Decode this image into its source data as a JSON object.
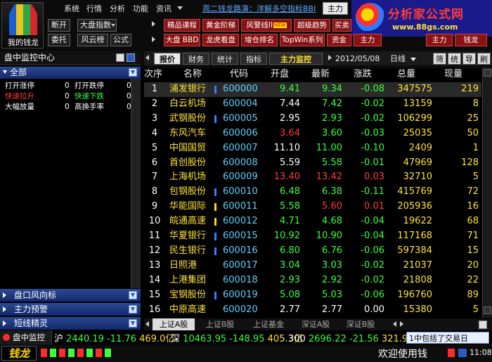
{
  "app": {
    "logo_label": "我的钱龙"
  },
  "menu": [
    "系统",
    "行情",
    "分析",
    "功能",
    "资讯"
  ],
  "banner": "周二钱龙路演：洋解多空指标BBI",
  "tab_main": "主力",
  "ad": {
    "title": "分析家公式网",
    "url": "www.88gs.com"
  },
  "toolbar1": {
    "duankai": "断开",
    "dapan": "大盘指数",
    "weituo": "委托",
    "fengyun": "风云榜",
    "gongshi": "公式"
  },
  "redbuttons_row1": [
    "精品课程",
    "黄金阶梯",
    "风警线II",
    "超级趋势",
    "买卖"
  ],
  "redbuttons_row2": [
    "大盘 BBD",
    "龙虎看盘",
    "增仓排名",
    "TopWin系列",
    "资金",
    "主力"
  ],
  "right_small_buttons": [
    "主力",
    "钱龙"
  ],
  "left_panel": {
    "title": "盘中监控中心",
    "header": "全部",
    "items": [
      {
        "label": "打开涨停",
        "value": "0",
        "label2": "打开跌停",
        "value2": "0",
        "c1": "#ffffff",
        "c2": "#ffffff"
      },
      {
        "label": "快速拉升",
        "value": "0",
        "label2": "快速下跌",
        "value2": "0",
        "c1": "#ff3b3b",
        "c2": "#3cff3c"
      },
      {
        "label": "大幅放量",
        "value": "0",
        "label2": "高换手率",
        "value2": "0",
        "c1": "#ffffff",
        "c2": "#ffffff"
      }
    ],
    "sections": [
      "盘口风向标",
      "主力预警",
      "短线精灵"
    ],
    "footer": "盘中监控"
  },
  "right_tabs": [
    "报价",
    "财务",
    "统计",
    "指标",
    "主力监控"
  ],
  "date": "2012/05/08",
  "period": "日线",
  "side_buttons": [
    "筛",
    "统",
    "导",
    "刷"
  ],
  "columns": [
    "次序",
    "名称",
    "代码",
    "开盘",
    "最新",
    "涨跌",
    "总量",
    "现量"
  ],
  "rows": [
    {
      "idx": "1",
      "name": "浦发银行",
      "code": "600000",
      "open": "9.41",
      "last": "9.34",
      "chg": "-0.08",
      "vol": "347575",
      "cur": "219",
      "openc": "#3cff3c",
      "lastc": "#3cff3c",
      "chgc": "#3cff3c",
      "mark": "blue"
    },
    {
      "idx": "2",
      "name": "白云机场",
      "code": "600004",
      "open": "7.44",
      "last": "7.42",
      "chg": "-0.02",
      "vol": "13159",
      "cur": "8",
      "openc": "#ffffff",
      "lastc": "#3cff3c",
      "chgc": "#3cff3c",
      "mark": ""
    },
    {
      "idx": "3",
      "name": "武钢股份",
      "code": "600005",
      "open": "2.95",
      "last": "2.93",
      "chg": "-0.02",
      "vol": "106299",
      "cur": "25",
      "openc": "#ffffff",
      "lastc": "#3cff3c",
      "chgc": "#3cff3c",
      "mark": "blue"
    },
    {
      "idx": "4",
      "name": "东风汽车",
      "code": "600006",
      "open": "3.64",
      "last": "3.60",
      "chg": "-0.03",
      "vol": "25035",
      "cur": "50",
      "openc": "#ff3b3b",
      "lastc": "#3cff3c",
      "chgc": "#3cff3c",
      "mark": ""
    },
    {
      "idx": "5",
      "name": "中国国贸",
      "code": "600007",
      "open": "11.10",
      "last": "11.00",
      "chg": "-0.10",
      "vol": "2409",
      "cur": "1",
      "openc": "#ffffff",
      "lastc": "#3cff3c",
      "chgc": "#3cff3c",
      "mark": ""
    },
    {
      "idx": "6",
      "name": "首创股份",
      "code": "600008",
      "open": "5.59",
      "last": "5.58",
      "chg": "-0.01",
      "vol": "47969",
      "cur": "128",
      "openc": "#ffffff",
      "lastc": "#3cff3c",
      "chgc": "#3cff3c",
      "mark": ""
    },
    {
      "idx": "7",
      "name": "上海机场",
      "code": "600009",
      "open": "13.40",
      "last": "13.42",
      "chg": "0.03",
      "vol": "32710",
      "cur": "5",
      "openc": "#ff3b3b",
      "lastc": "#ff3b3b",
      "chgc": "#ff3b3b",
      "mark": ""
    },
    {
      "idx": "8",
      "name": "包钢股份",
      "code": "600010",
      "open": "6.48",
      "last": "6.38",
      "chg": "-0.11",
      "vol": "415769",
      "cur": "72",
      "openc": "#3cff3c",
      "lastc": "#3cff3c",
      "chgc": "#3cff3c",
      "mark": "blue"
    },
    {
      "idx": "9",
      "name": "华能国际",
      "code": "600011",
      "open": "5.58",
      "last": "5.60",
      "chg": "0.01",
      "vol": "205936",
      "cur": "16",
      "openc": "#3cff3c",
      "lastc": "#ff3b3b",
      "chgc": "#ff3b3b",
      "mark": "yellow"
    },
    {
      "idx": "10",
      "name": "皖通高速",
      "code": "600012",
      "open": "4.71",
      "last": "4.68",
      "chg": "-0.04",
      "vol": "19622",
      "cur": "68",
      "openc": "#3cff3c",
      "lastc": "#3cff3c",
      "chgc": "#3cff3c",
      "mark": "yellow"
    },
    {
      "idx": "11",
      "name": "华夏银行",
      "code": "600015",
      "open": "10.92",
      "last": "10.90",
      "chg": "-0.04",
      "vol": "117168",
      "cur": "71",
      "openc": "#3cff3c",
      "lastc": "#3cff3c",
      "chgc": "#3cff3c",
      "mark": "blue"
    },
    {
      "idx": "12",
      "name": "民生银行",
      "code": "600016",
      "open": "6.80",
      "last": "6.76",
      "chg": "-0.06",
      "vol": "597384",
      "cur": "15",
      "openc": "#3cff3c",
      "lastc": "#3cff3c",
      "chgc": "#3cff3c",
      "mark": "blue"
    },
    {
      "idx": "13",
      "name": "日照港",
      "code": "600017",
      "open": "3.04",
      "last": "3.03",
      "chg": "-0.02",
      "vol": "21037",
      "cur": "20",
      "openc": "#3cff3c",
      "lastc": "#3cff3c",
      "chgc": "#3cff3c",
      "mark": ""
    },
    {
      "idx": "14",
      "name": "上港集团",
      "code": "600018",
      "open": "2.93",
      "last": "2.92",
      "chg": "-0.02",
      "vol": "21808",
      "cur": "22",
      "openc": "#3cff3c",
      "lastc": "#3cff3c",
      "chgc": "#3cff3c",
      "mark": ""
    },
    {
      "idx": "15",
      "name": "宝钢股份",
      "code": "600019",
      "open": "5.08",
      "last": "5.03",
      "chg": "-0.06",
      "vol": "196760",
      "cur": "89",
      "openc": "#3cff3c",
      "lastc": "#3cff3c",
      "chgc": "#3cff3c",
      "mark": "blue"
    },
    {
      "idx": "16",
      "name": "中原高速",
      "code": "600020",
      "open": "2.77",
      "last": "2.77",
      "chg": "0.00",
      "vol": "15380",
      "cur": "5",
      "openc": "#ffffff",
      "lastc": "#ffffff",
      "chgc": "#ffffff",
      "mark": ""
    }
  ],
  "bottom_tabs": [
    "上证A股",
    "上证B股",
    "上证基金",
    "深证A股",
    "深证B股"
  ],
  "ticker": {
    "sh_label": "沪",
    "sh_value": "2440.19",
    "sh_chg": "-11.76",
    "sh_amt": "469.0亿",
    "sz_label": "深",
    "sz_value": "10463.95",
    "sz_chg": "-148.95",
    "sz_amt": "405.3亿",
    "c300_label": "300",
    "c300_value": "2696.22",
    "c300_chg": "-21.56",
    "c300_amt": "321.9亿"
  },
  "notice": "1中包括了交易日",
  "status": {
    "brand": "钱龙",
    "welcome": "欢迎使用钱",
    "time": "11:08"
  }
}
